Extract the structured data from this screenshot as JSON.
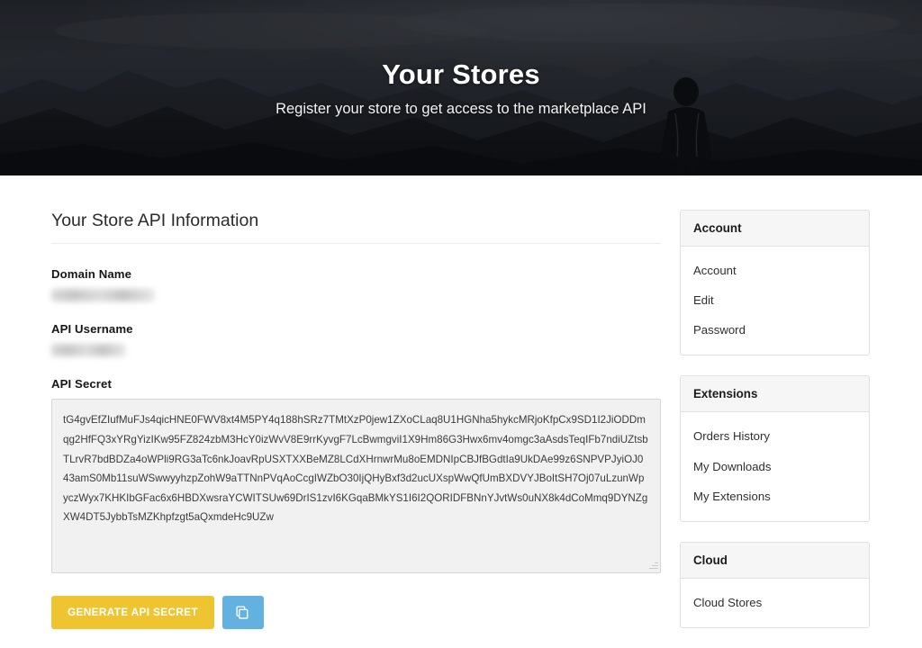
{
  "hero": {
    "title": "Your Stores",
    "subtitle": "Register your store to get access to the marketplace API",
    "image_alt": "hiker-silhouette-mountains"
  },
  "main": {
    "panel_title": "Your Store API Information",
    "fields": [
      {
        "label": "Domain Name",
        "value": "",
        "redacted": true
      },
      {
        "label": "API Username",
        "value": "",
        "redacted": true
      }
    ],
    "secret_label": "API Secret",
    "secret_value": "tG4gvEfZIufMuFJs4qicHNE0FWV8xt4M5PY4q188hSRz7TMtXzP0jew1ZXoCLaq8U1HGNha5hykcMRjoKfpCx9SD1I2JiODDmqg2HfFQ3xYRgYizIKw95FZ824zbM3HcY0izWvV8E9rrKyvgF7LcBwmgviI1X9Hm86G3Hwx6mv4omgc3aAsdsTeqIFb7ndiUZtsbTLrvR7bdBDZa4oWPli9RG3aTc6nkJoavRpUSXTXXBeMZ8LCdXHrnwrMu8oEMDNIpCBJfBGdtIa9UkDAe99z6SNPVPJyiOJ043amS0Mb11suWSwwyyhzpZohW9aTTNnPVqAoCcgIWZbO30IjQHyBxf3d2ucUXspWwQfUmBXDVYJBoItSH7Oj07uLzunWpyczWyx7KHKIbGFac6x6HBDXwsraYCWITSUw69DrIS1zvI6KGqaBMkYS1I6I2QORIDFBNnYJvtWs0uNX8k4dCoMmq9DYNZgXW4DT5JybbTsMZKhpfzgt5aQxmdeHc9UZw",
    "generate_button": "GENERATE API SECRET",
    "copy_button_icon": "copy-icon"
  },
  "sidebar": {
    "cards": [
      {
        "title": "Account",
        "items": [
          "Account",
          "Edit",
          "Password"
        ]
      },
      {
        "title": "Extensions",
        "items": [
          "Orders History",
          "My Downloads",
          "My Extensions"
        ]
      },
      {
        "title": "Cloud",
        "items": [
          "Cloud Stores"
        ]
      }
    ]
  },
  "colors": {
    "accent_yellow": "#efc431",
    "accent_blue": "#63b1e0",
    "hero_dark": "#14161a",
    "card_head": "#f6f6f6",
    "textarea_bg": "#f1f1f1"
  }
}
